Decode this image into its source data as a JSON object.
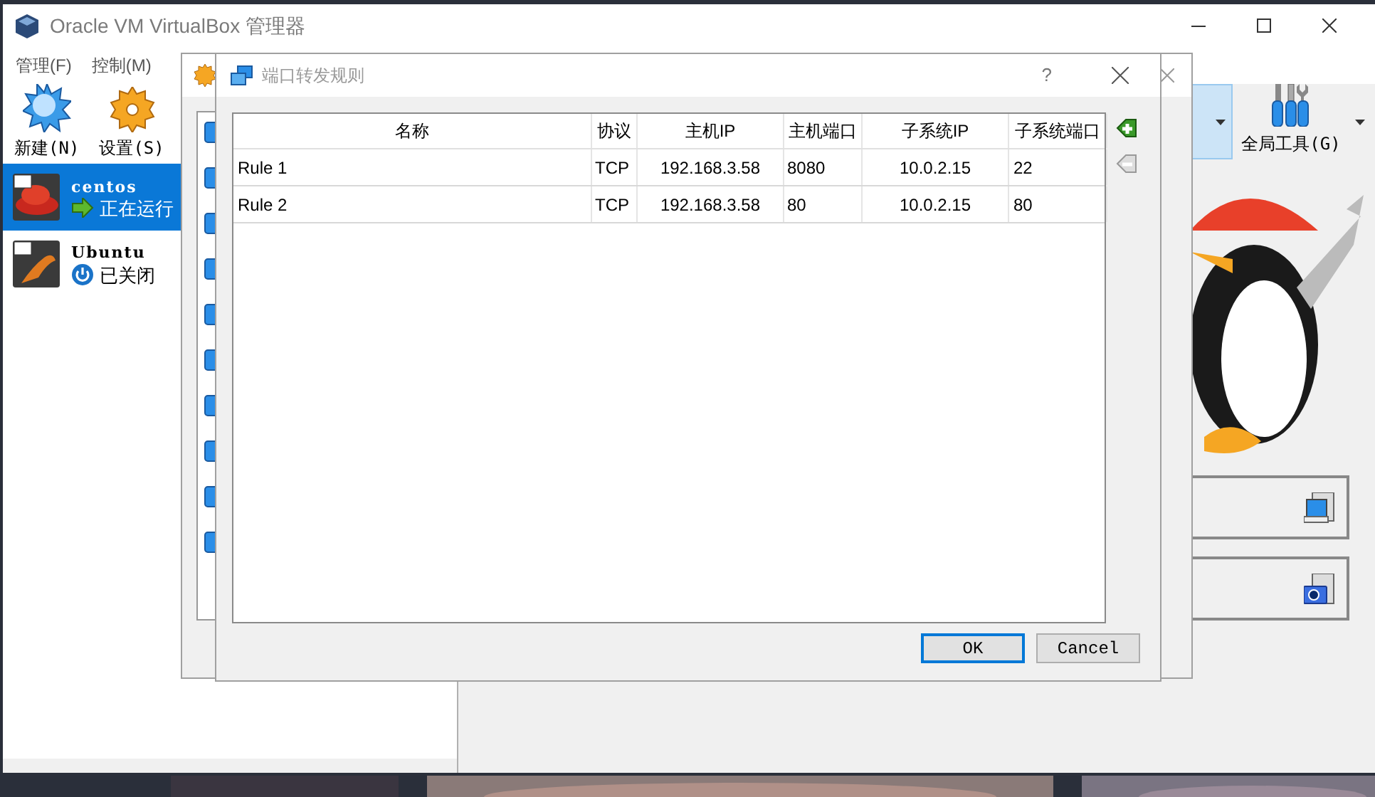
{
  "main_window": {
    "title": "Oracle VM VirtualBox 管理器",
    "menu": [
      "管理(F)",
      "控制(M)"
    ],
    "toolbar": [
      {
        "label": "新建(N)",
        "kind": "new"
      },
      {
        "label": "设置(S)",
        "kind": "settings"
      }
    ],
    "vms": [
      {
        "name": "centos",
        "status": "正在运行",
        "kind": "running",
        "selected": true
      },
      {
        "name": "Ubuntu",
        "status": "已关闭",
        "kind": "off",
        "selected": false
      }
    ],
    "global_tools": {
      "label": "全局工具(G)"
    }
  },
  "dialog": {
    "title": "端口转发规则",
    "help": "?",
    "columns": [
      "名称",
      "协议",
      "主机IP",
      "主机端口",
      "子系统IP",
      "子系统端口"
    ],
    "rows": [
      {
        "cells": [
          "Rule 1",
          "TCP",
          "192.168.3.58",
          "8080",
          "10.0.2.15",
          "22"
        ]
      },
      {
        "cells": [
          "Rule 2",
          "TCP",
          "192.168.3.58",
          "80",
          "10.0.2.15",
          "80"
        ]
      }
    ],
    "buttons": [
      {
        "label": "OK",
        "default": true
      },
      {
        "label": "Cancel",
        "default": false
      }
    ]
  }
}
